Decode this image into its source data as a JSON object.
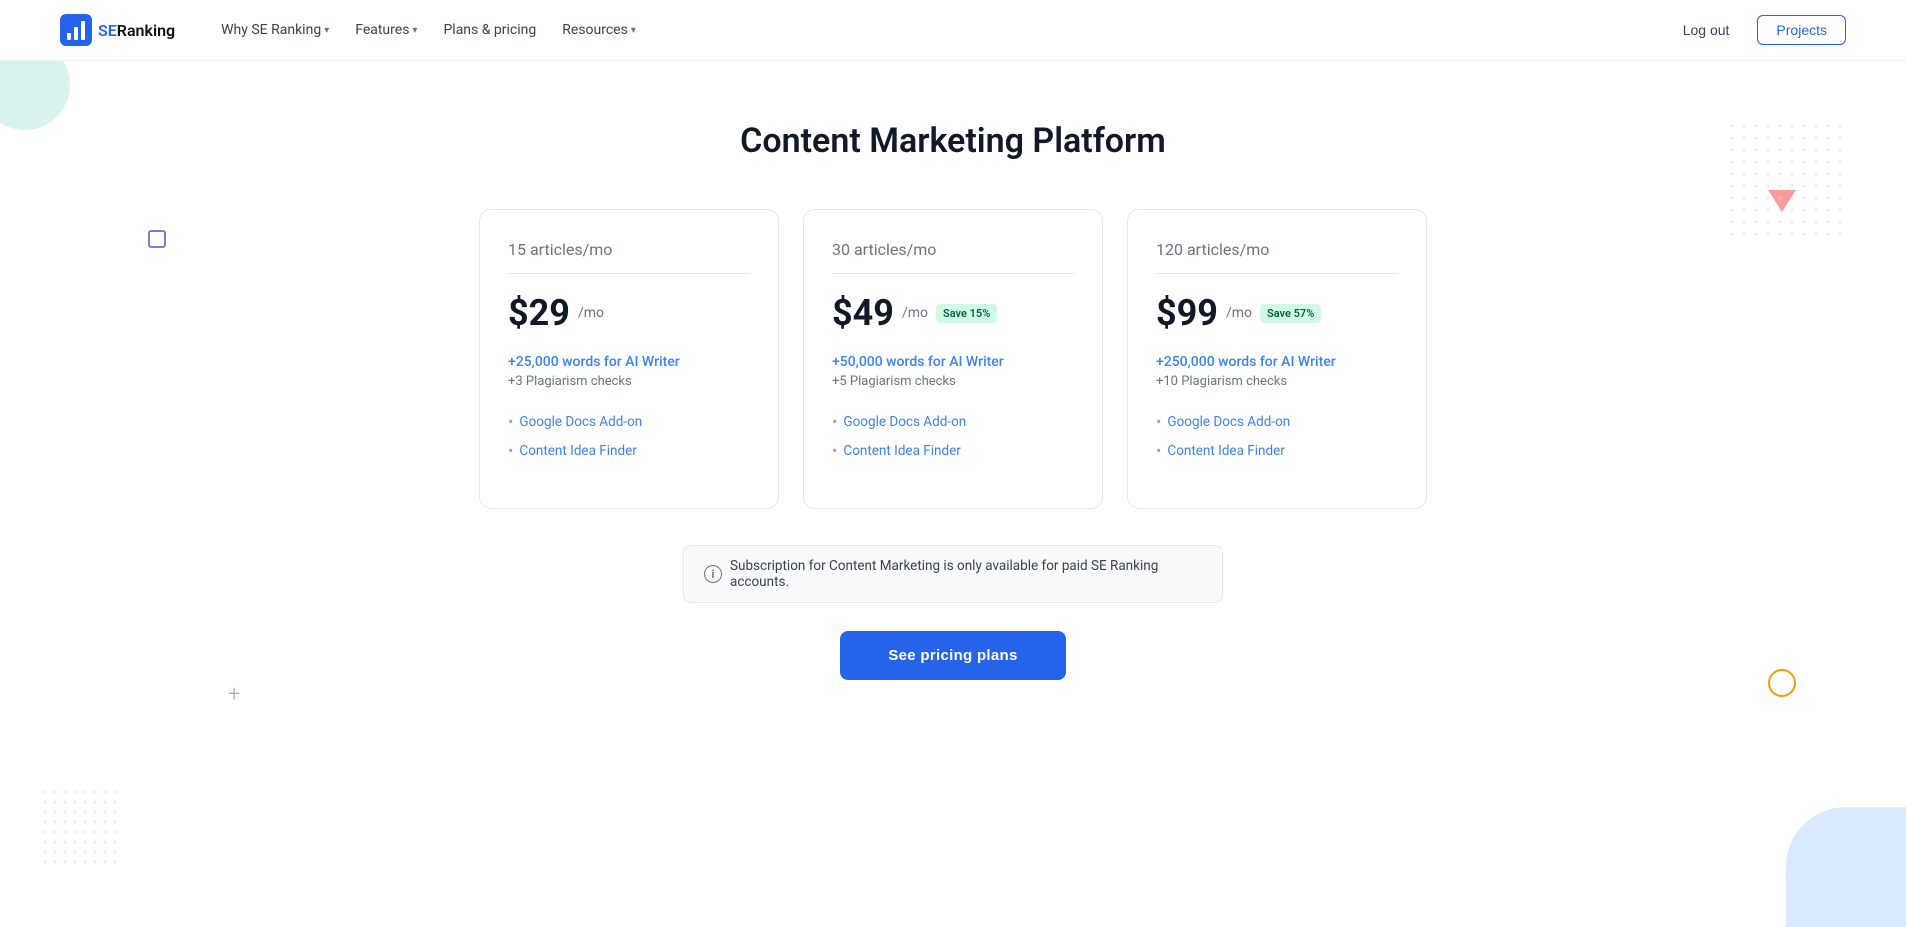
{
  "brand": {
    "logo_text_se": "SE",
    "logo_text_ranking": "Ranking",
    "logo_alt": "SE Ranking logo"
  },
  "nav": {
    "links": [
      {
        "label": "Why SE Ranking",
        "has_dropdown": true
      },
      {
        "label": "Features",
        "has_dropdown": true
      },
      {
        "label": "Plans & pricing",
        "has_dropdown": false
      },
      {
        "label": "Resources",
        "has_dropdown": true
      }
    ],
    "logout_label": "Log out",
    "projects_label": "Projects"
  },
  "page": {
    "title": "Content Marketing Platform"
  },
  "plans": [
    {
      "articles": "15 articles",
      "period": "/mo",
      "price": "$29",
      "price_period": "/mo",
      "save_badge": null,
      "ai_words": "+25,000 words for AI Writer",
      "plagiarism": "+3 Plagiarism checks",
      "features": [
        "Google Docs Add-on",
        "Content Idea Finder"
      ]
    },
    {
      "articles": "30 articles",
      "period": "/mo",
      "price": "$49",
      "price_period": "/mo",
      "save_badge": "Save 15%",
      "ai_words": "+50,000 words for AI Writer",
      "plagiarism": "+5 Plagiarism checks",
      "features": [
        "Google Docs Add-on",
        "Content Idea Finder"
      ]
    },
    {
      "articles": "120 articles",
      "period": "/mo",
      "price": "$99",
      "price_period": "/mo",
      "save_badge": "Save 57%",
      "ai_words": "+250,000 words for AI Writer",
      "plagiarism": "+10 Plagiarism checks",
      "features": [
        "Google Docs Add-on",
        "Content Idea Finder"
      ]
    }
  ],
  "notice": {
    "text": "Subscription for Content Marketing is only available for paid SE Ranking accounts."
  },
  "cta": {
    "label": "See pricing plans"
  }
}
